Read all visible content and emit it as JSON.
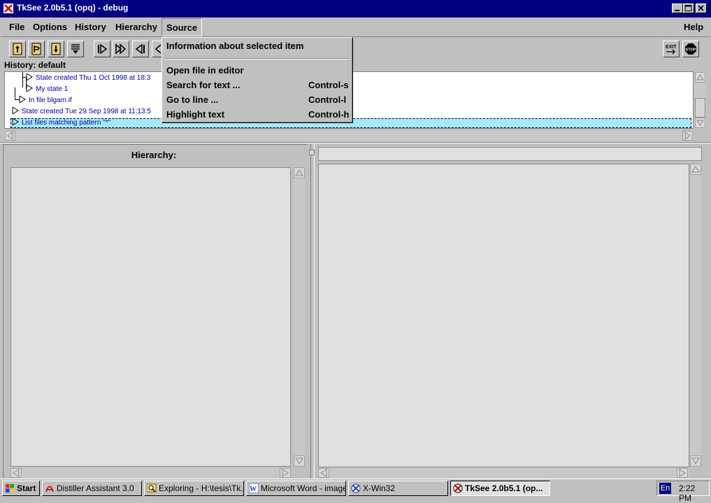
{
  "window": {
    "title": "TkSee 2.0b5.1 (opq) - debug"
  },
  "menubar": {
    "file": "File",
    "options": "Options",
    "history": "History",
    "hierarchy": "Hierarchy",
    "source": "Source",
    "help": "Help"
  },
  "history": {
    "label": "History: default",
    "rows": [
      "State created Thu 1 Oct 1998 at 18:3",
      "My state 1",
      "In file blgam.if",
      "State created Tue 29 Sep 1998 at 11:13:5",
      "List files matching pattern \"*\""
    ]
  },
  "hierarchy": {
    "title": "Hierarchy:"
  },
  "source_menu": {
    "info": "Information about selected item",
    "open": "Open file in editor",
    "search": "Search for text ...",
    "search_key": "Control-s",
    "goto": "Go to line ...",
    "goto_key": "Control-l",
    "highlight": "Highlight text",
    "highlight_key": "Control-h"
  },
  "toolbar": {
    "exit_label": "EXIT",
    "stop_label": "STOP"
  },
  "taskbar": {
    "start": "Start",
    "tasks": [
      "Distiller Assistant 3.0",
      "Exploring - H:\\tesis\\Tk...",
      "Microsoft Word - image...",
      "X-Win32",
      "TkSee 2.0b5.1 (op..."
    ],
    "lang": "En",
    "clock": "2:22 PM"
  }
}
